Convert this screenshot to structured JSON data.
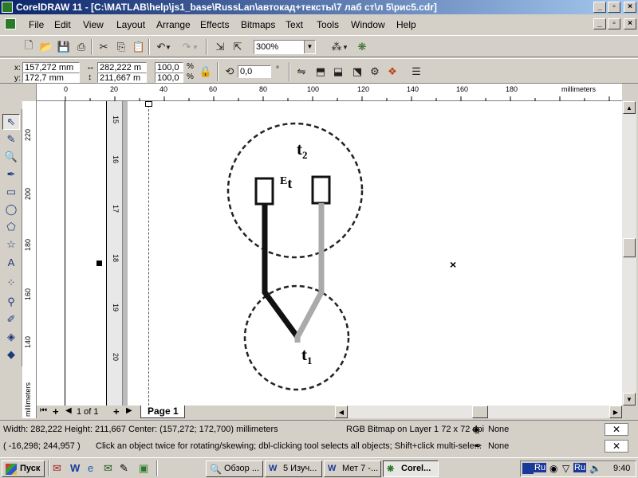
{
  "window": {
    "title": "CorelDRAW 11 - [C:\\MATLAB\\help\\js1_base\\RussLan\\автокад+тексты\\7 лаб ст\\л 5\\рис5.cdr]",
    "min_btn": "_",
    "max_btn": "▫",
    "close_btn": "×"
  },
  "menu": [
    "File",
    "Edit",
    "View",
    "Layout",
    "Arrange",
    "Effects",
    "Bitmaps",
    "Text",
    "Tools",
    "Window",
    "Help"
  ],
  "standard_toolbar": {
    "zoom_value": "300%"
  },
  "property_bar": {
    "x_label": "x:",
    "x_value": "157,272 mm",
    "y_label": "y:",
    "y_value": "172,7 mm",
    "width_value": "282,222 m",
    "height_value": "211,667 m",
    "scale_x": "100,0",
    "scale_y": "100,0",
    "percent": "%",
    "rotation_value": "0,0",
    "degree": "°"
  },
  "ruler": {
    "units": "millimeters",
    "h_ticks": [
      "0",
      "20",
      "40",
      "60",
      "80",
      "100",
      "120",
      "140",
      "160",
      "180"
    ],
    "v_ticks": [
      "220",
      "200",
      "180",
      "160",
      "140"
    ],
    "inner_v_ticks": [
      "15",
      "16",
      "17",
      "18",
      "19",
      "20"
    ],
    "inner_h_ticks": [
      "20",
      "40"
    ]
  },
  "drawing": {
    "label_t2": "t",
    "label_t2_sub": "2",
    "label_et": "E",
    "label_et_sub": "t",
    "label_t1": "t",
    "label_t1_sub": "1"
  },
  "page_nav": {
    "page_count": "1 of 1",
    "page_tab": "Page 1"
  },
  "status": {
    "dimensions": "Width: 282,222  Height: 211,667  Center: (157,272; 172,700)  millimeters",
    "object_info": "RGB Bitmap on Layer 1 72 x 72 dpi",
    "cursor_pos": "( -16,298; 244,957 )",
    "hint": "Click an object twice for rotating/skewing; dbl-clicking tool selects all objects; Shift+click multi-sele...",
    "fill_none": "None",
    "outline_none": "None"
  },
  "taskbar": {
    "start": "Пуск",
    "tasks": [
      "Обзор ...",
      "5 Изуч...",
      "Мет 7 -...",
      "Corel..."
    ],
    "clock": "9:40",
    "lang": "Ru"
  }
}
